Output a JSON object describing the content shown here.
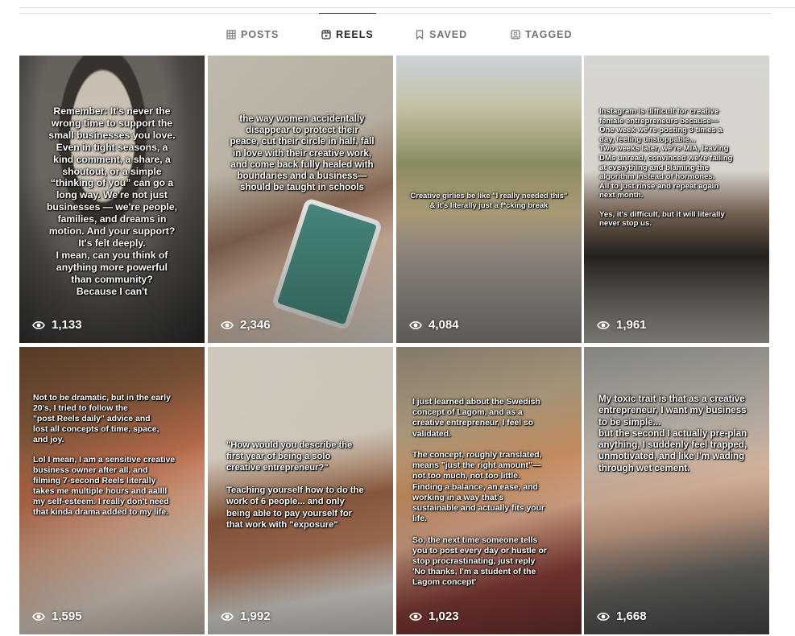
{
  "tabs": [
    {
      "label": "POSTS",
      "icon": "grid-icon"
    },
    {
      "label": "REELS",
      "icon": "reels-icon",
      "active": true
    },
    {
      "label": "SAVED",
      "icon": "bookmark-icon"
    },
    {
      "label": "TAGGED",
      "icon": "tag-user-icon"
    }
  ],
  "reels": [
    {
      "views": "1,133",
      "caption": "Remember: It's never the\nwrong time to support the\nsmall businesses you love.\nEven in tight seasons, a\nkind comment, a share, a\nshoutout, or a simple\n“thinking of you” can go a\nlong way. We're not just\nbusinesses — we're people,\nfamilies, and dreams in\nmotion. And your support?\nIt's felt deeply.\nI mean, can you think of\nanything more powerful\nthan community?\nBecause I can't"
    },
    {
      "views": "2,346",
      "caption": "the way women accidentally\ndisappear to protect their\npeace, cut their circle in half, fall\nin love with their creative work,\nand come back fully healed with\nboundaries and a business—\nshould be taught in schools"
    },
    {
      "views": "4,084",
      "caption": "Creative girlies be like \"I really needed this\"\n& it's literally just a f*cking break"
    },
    {
      "views": "1,961",
      "caption": "Instagram is difficult for creative\nfemale entrepreneurs because—\nOne week we're posting 3 times a\nday, feeling unstoppable...\nTwo weeks later, we're MIA, leaving\nDMs unread, convinced we're failing\nat everything and blaming the\nalgorithm instead of hormones.\nAll to just rinse and repeat again\nnext month.\n\nYes, it's difficult, but it will literally\nnever stop us."
    },
    {
      "views": "1,595",
      "caption": "Not to be dramatic, but in the early\n20's, I tried to follow the\n\"post Reels daily\" advice and\nlost all concepts of time, space,\nand joy.\n\nLol I mean, I am a sensitive creative\nbusiness owner after all, and\nfilming 7-second Reels literally\ntakes me multiple hours and aallll\nmy self-esteem. I really don't need\nthat kinda drama added to my life."
    },
    {
      "views": "1,992",
      "caption": "\"How would you describe the\nfirst year of being a solo\ncreative entrepreneur?\"\n\nTeaching yourself how to do the\nwork of 6 people... and only\nbeing able to pay yourself for\nthat work with \"exposure\""
    },
    {
      "views": "1,023",
      "caption": "I just learned about the Swedish\nconcept of Lagom, and as a\ncreative entrepreneur, I feel so\nvalidated.\n\nThe concept, roughly translated,\nmeans \"just the right amount\"—\nnot too much, not too little.\nFinding a balance, an ease, and\nworking in a way that's\nsustainable and actually fits your\nlife.\n\nSo, the next time someone tells\nyou to post every day or hustle or\nstop procrastinating, just reply\n'No thanks, I'm a student of the\nLagom concept'"
    },
    {
      "views": "1,668",
      "caption": "My toxic trait is that as a creative\nentrepreneur, I want my business\nto be simple...\nbut the second I actually pre-plan\nanything, I suddenly feel trapped,\nunmotivated, and like I'm wading\nthrough wet cement."
    }
  ],
  "colors": {
    "tab_active": "#262626",
    "tab_inactive": "#737373",
    "divider": "#dbdbdb"
  }
}
